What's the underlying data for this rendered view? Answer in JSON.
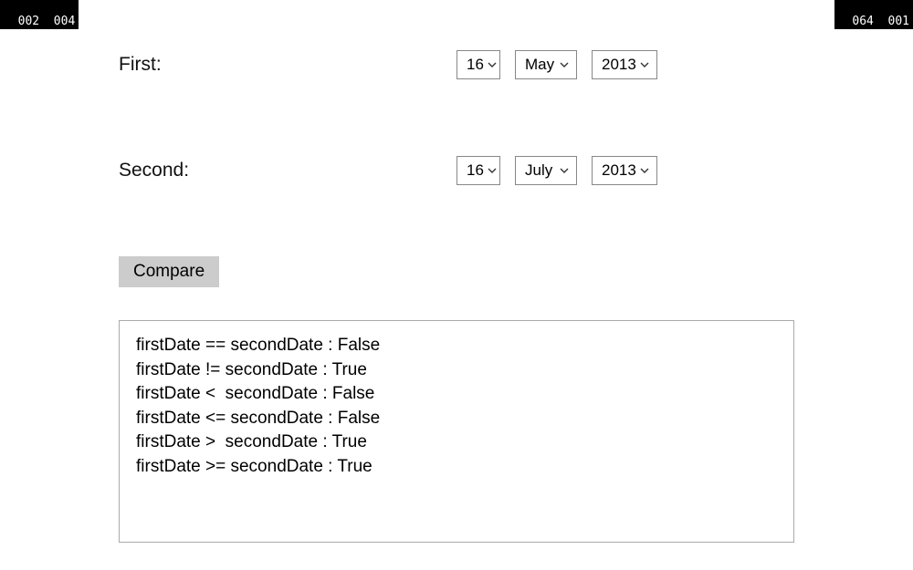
{
  "corners": {
    "top_left_1": "002",
    "top_left_2": "004",
    "top_right_1": "064",
    "top_right_2": "001"
  },
  "rows": {
    "first": {
      "label": "First:",
      "day": "16",
      "month": "May",
      "year": "2013"
    },
    "second": {
      "label": "Second:",
      "day": "16",
      "month": "July",
      "year": "2013"
    }
  },
  "compare_label": "Compare",
  "output": {
    "l1": "firstDate == secondDate : False",
    "l2": "firstDate != secondDate : True",
    "l3": "firstDate <  secondDate : False",
    "l4": "firstDate <= secondDate : False",
    "l5": "firstDate >  secondDate : True",
    "l6": "firstDate >= secondDate : True"
  }
}
